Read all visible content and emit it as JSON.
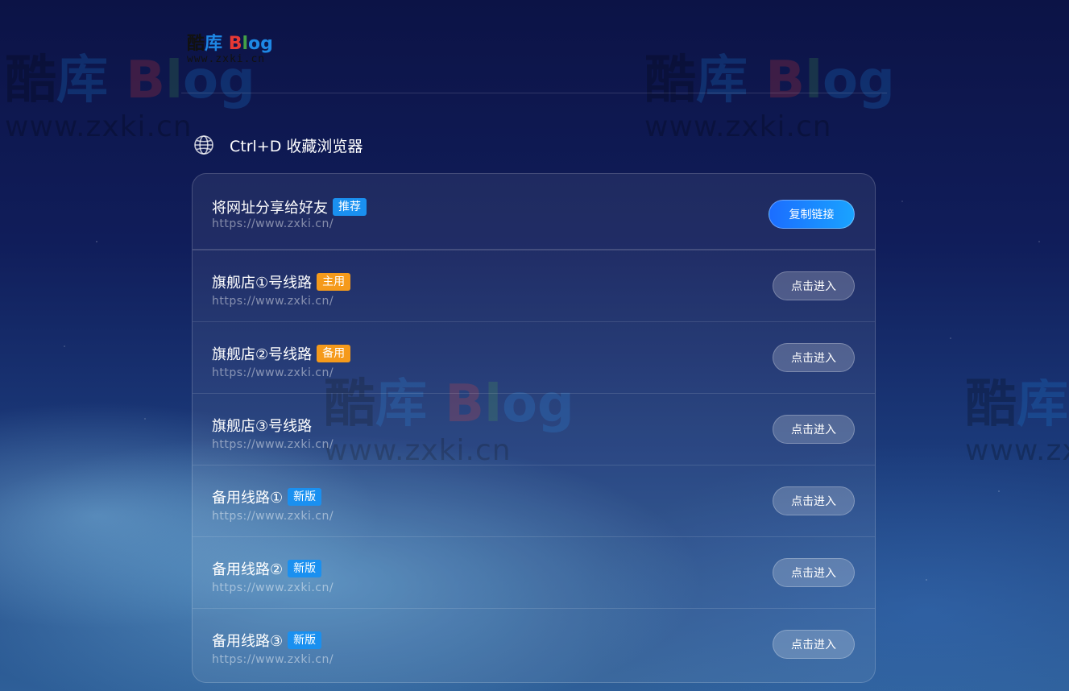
{
  "logo": {
    "brand_chars": [
      "酷",
      "库"
    ],
    "brand_latin": [
      "B",
      "l",
      "o",
      "g"
    ],
    "url": "www.zxki.cn"
  },
  "watermark": {
    "brand_chars": [
      "酷",
      "库"
    ],
    "brand_latin": [
      "B",
      "l",
      "o",
      "g"
    ],
    "url": "www.zxki.cn"
  },
  "bookmark": {
    "icon": "globe-icon",
    "text": "Ctrl+D 收藏浏览器"
  },
  "rows": [
    {
      "title": "将网址分享给好友",
      "badge": "推荐",
      "badge_color": "#1a90f0",
      "url": "https://www.zxki.cn/",
      "button": "复制链接"
    },
    {
      "title": "旗舰店①号线路",
      "badge": "主用",
      "badge_color": "#f59a1b",
      "url": "https://www.zxki.cn/",
      "button": "点击进入"
    },
    {
      "title": "旗舰店②号线路",
      "badge": "备用",
      "badge_color": "#f59a1b",
      "url": "https://www.zxki.cn/",
      "button": "点击进入"
    },
    {
      "title": "旗舰店③号线路",
      "badge": "",
      "badge_color": "",
      "url": "https://www.zxki.cn/",
      "button": "点击进入"
    },
    {
      "title": "备用线路①",
      "badge": "新版",
      "badge_color": "#1a90f0",
      "url": "https://www.zxki.cn/",
      "button": "点击进入"
    },
    {
      "title": "备用线路②",
      "badge": "新版",
      "badge_color": "#1a90f0",
      "url": "https://www.zxki.cn/",
      "button": "点击进入"
    },
    {
      "title": "备用线路③",
      "badge": "新版",
      "badge_color": "#1a90f0",
      "url": "https://www.zxki.cn/",
      "button": "点击进入"
    }
  ],
  "colors": {
    "copy_button_gradient": [
      "#1b6dff",
      "#1aa3ff"
    ],
    "badge_blue": "#1a90f0",
    "badge_orange": "#f59a1b"
  }
}
